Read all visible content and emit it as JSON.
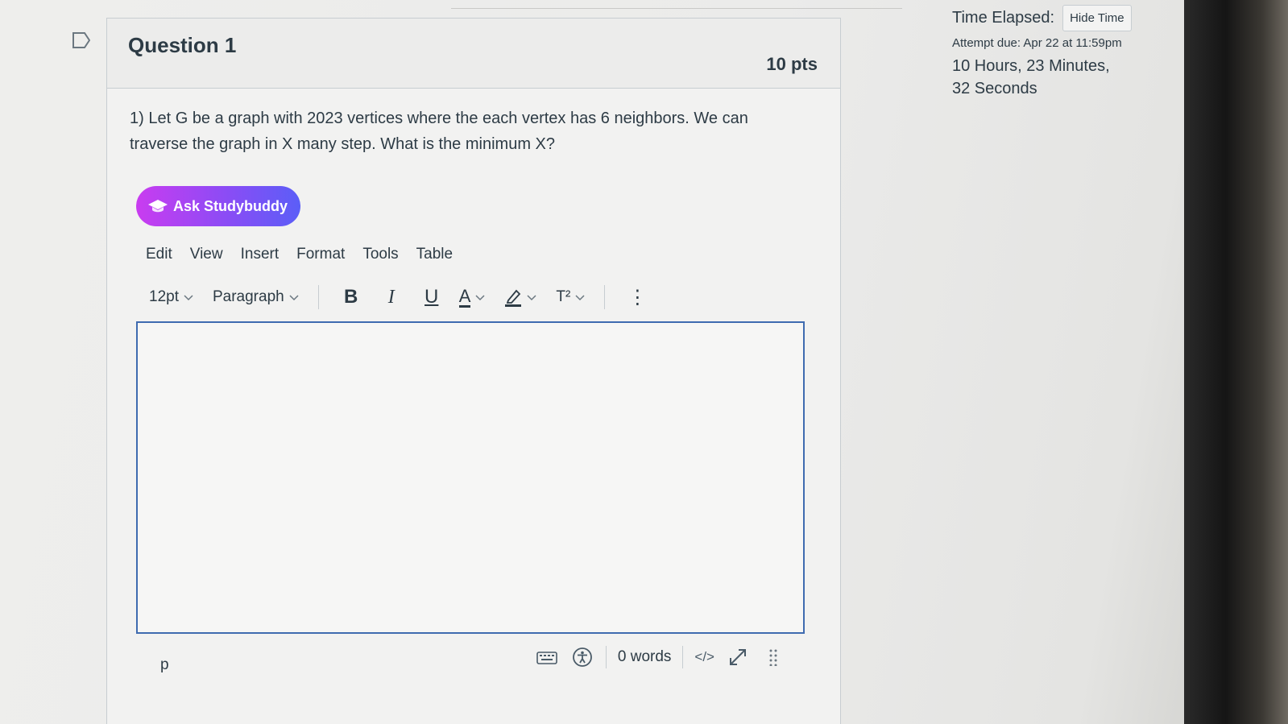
{
  "question": {
    "title": "Question 1",
    "points": "10 pts",
    "text": "1) Let G be a graph with 2023 vertices where the each vertex has 6 neighbors. We can traverse the graph in X many step. What is the minimum X?"
  },
  "studybuddy": {
    "label": "Ask Studybuddy"
  },
  "editor": {
    "menu": [
      "Edit",
      "View",
      "Insert",
      "Format",
      "Tools",
      "Table"
    ],
    "font_size": "12pt",
    "block_format": "Paragraph",
    "bold_glyph": "B",
    "italic_glyph": "I",
    "underline_glyph": "U",
    "text_color_glyph": "A",
    "superscript_glyph": "T²",
    "more_glyph": "⋮",
    "path": "p",
    "word_count": "0 words",
    "html_toggle": "</>"
  },
  "timer": {
    "label": "Time Elapsed:",
    "hide_button": "Hide Time",
    "attempt_due": "Attempt due: Apr 22 at 11:59pm",
    "elapsed": "10 Hours, 23 Minutes, 32 Seconds"
  },
  "colors": {
    "editor_border": "#3f6bb0",
    "studybuddy_start": "#c93cf0",
    "studybuddy_end": "#5b5ef7",
    "text": "#2d3b45"
  }
}
